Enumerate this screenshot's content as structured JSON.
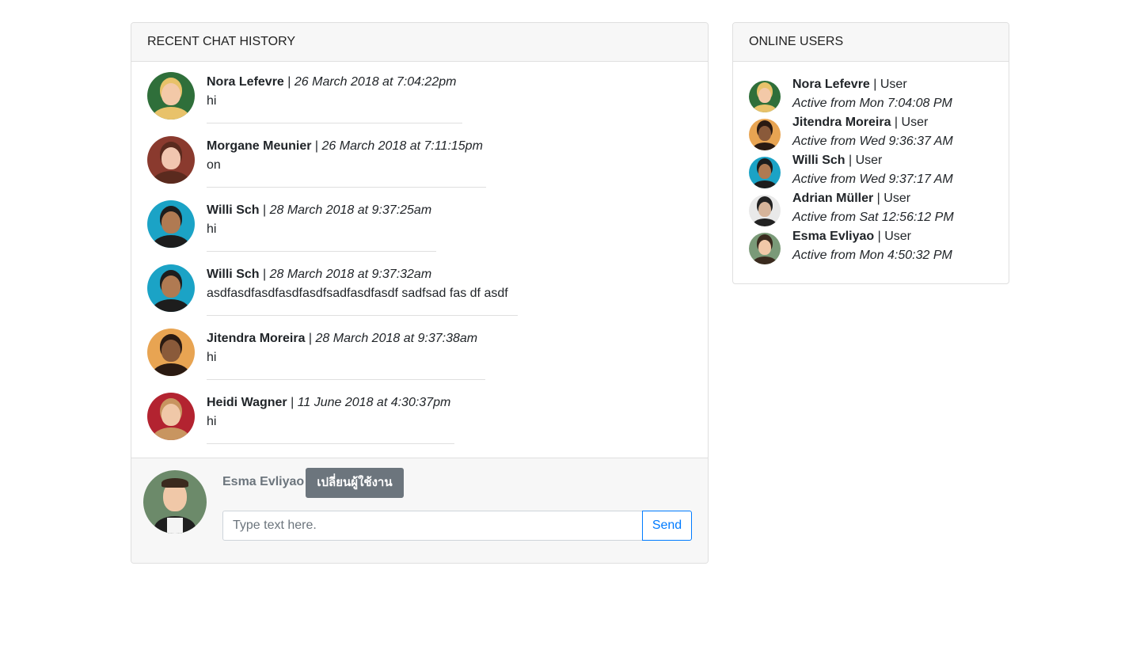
{
  "chat_panel": {
    "title": "RECENT CHAT HISTORY",
    "messages": [
      {
        "name": "Nora Lefevre",
        "separator": " | ",
        "time": "26 March 2018 at 7:04:22pm",
        "text": "hi",
        "avatar_bg": "#2f6f3a",
        "skin": "#f3c9a8",
        "hair": "#e8c26a"
      },
      {
        "name": "Morgane Meunier",
        "separator": " | ",
        "time": "26 March 2018 at 7:11:15pm",
        "text": "on",
        "avatar_bg": "#8a3a2e",
        "skin": "#f1c6b0",
        "hair": "#5a2a1e"
      },
      {
        "name": "Willi Sch",
        "separator": " | ",
        "time": "28 March 2018 at 9:37:25am",
        "text": "hi",
        "avatar_bg": "#1ba3c6",
        "skin": "#b07a52",
        "hair": "#1d1d1d"
      },
      {
        "name": "Willi Sch",
        "separator": " | ",
        "time": "28 March 2018 at 9:37:32am",
        "text": "asdfasdfasdfasdfasdfsadfasdfasdf sadfsad fas df asdf",
        "avatar_bg": "#1ba3c6",
        "skin": "#b07a52",
        "hair": "#1d1d1d"
      },
      {
        "name": "Jitendra Moreira",
        "separator": " | ",
        "time": "28 March 2018 at 9:37:38am",
        "text": "hi",
        "avatar_bg": "#e8a452",
        "skin": "#8a5a3a",
        "hair": "#2a1a12"
      },
      {
        "name": "Heidi Wagner",
        "separator": " | ",
        "time": "11 June 2018 at 4:30:37pm",
        "text": "hi",
        "avatar_bg": "#b32330",
        "skin": "#f0c8a8",
        "hair": "#c89560"
      }
    ]
  },
  "composer": {
    "current_user": "Esma Evliyao",
    "switch_user_label": "เปลี่ยนผู้ใช้งาน",
    "input_placeholder": "Type text here.",
    "send_label": "Send"
  },
  "users_panel": {
    "title": "ONLINE USERS",
    "users": [
      {
        "name": "Nora Lefevre",
        "separator": " | ",
        "role": "User",
        "active": "Active from Mon 7:04:08 PM",
        "avatar_bg": "#2f6f3a",
        "skin": "#f3c9a8",
        "hair": "#e8c26a"
      },
      {
        "name": "Jitendra Moreira",
        "separator": " | ",
        "role": "User",
        "active": "Active from Wed 9:36:37 AM",
        "avatar_bg": "#e8a452",
        "skin": "#8a5a3a",
        "hair": "#2a1a12"
      },
      {
        "name": "Willi Sch",
        "separator": " | ",
        "role": "User",
        "active": "Active from Wed 9:37:17 AM",
        "avatar_bg": "#1ba3c6",
        "skin": "#b07a52",
        "hair": "#1d1d1d"
      },
      {
        "name": "Adrian Müller",
        "separator": " | ",
        "role": "User",
        "active": "Active from Sat 12:56:12 PM",
        "avatar_bg": "#e9e9e9",
        "skin": "#d6b49a",
        "hair": "#222222"
      },
      {
        "name": "Esma Evliyao",
        "separator": " | ",
        "role": "User",
        "active": "Active from Mon 4:50:32 PM",
        "avatar_bg": "#7a9a78",
        "skin": "#f0c8a8",
        "hair": "#3a2a1e"
      }
    ]
  }
}
